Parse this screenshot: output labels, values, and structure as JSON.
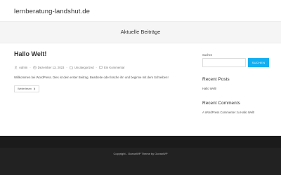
{
  "header": {
    "site_title": "lernberatung-landshut.de"
  },
  "page_header": {
    "title": "Aktuelle Beiträge"
  },
  "post": {
    "title": "Hallo Welt!",
    "meta": {
      "author": "Admin",
      "date": "Dezember 13, 2023",
      "category": "Uncategorized",
      "comments": "Ein Kommentar"
    },
    "excerpt": "Willkommen bei WordPress. Dies ist dein erster Beitrag. Bearbeite oder lösche ihn und beginne mit dem Schreiben!",
    "read_more_label": "Weiterlesen"
  },
  "sidebar": {
    "search_label": "Suchen",
    "search_placeholder": "",
    "search_button": "SUCHEN",
    "recent_posts_title": "Recent Posts",
    "recent_posts": [
      "Hallo Welt!"
    ],
    "recent_comments_title": "Recent Comments",
    "recent_comment": {
      "author": "A WordPress Commenter",
      "connector": "zu",
      "post": "Hallo Welt!"
    }
  },
  "footer": {
    "copyright": "Copyright - OceanWP Theme by OceanWP"
  },
  "colors": {
    "accent": "#13aff0",
    "footer_bg": "#1b1b1b",
    "page_header_bg": "#f5f5f5"
  },
  "icons": {
    "author": "user-icon",
    "date": "clock-icon",
    "category": "folder-icon",
    "comments": "comment-icon",
    "read_more": "chevron-right-icon"
  }
}
